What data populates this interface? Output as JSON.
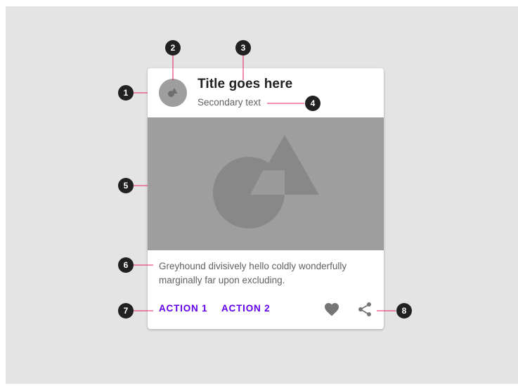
{
  "card": {
    "title": "Title goes here",
    "secondary_text": "Secondary text",
    "supporting_text": "Greyhound divisively hello coldly wonderfully marginally far upon excluding.",
    "actions": [
      "ACTION 1",
      "ACTION 2"
    ],
    "icons": [
      "favorite-icon",
      "share-icon"
    ]
  },
  "markers": [
    "1",
    "2",
    "3",
    "4",
    "5",
    "6",
    "7",
    "8"
  ],
  "colors": {
    "background": "#e4e4e4",
    "card": "#ffffff",
    "media": "#9e9e9e",
    "media_shapes": "#888888",
    "action_text": "#6200ee",
    "leader_line": "#e91e63",
    "marker": "#212121"
  }
}
